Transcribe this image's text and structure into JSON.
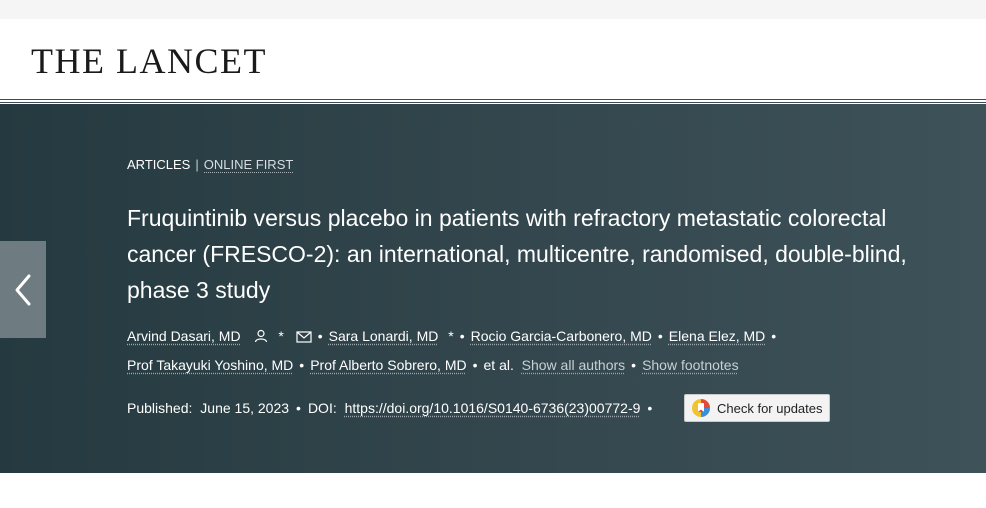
{
  "header": {
    "logo": "THE LANCET"
  },
  "article": {
    "type": "ARTICLES",
    "separator": "|",
    "status": "ONLINE FIRST",
    "title": "Fruquintinib versus placebo in patients with refractory metastatic colorectal cancer (FRESCO-2): an international, multicentre, randomised, double-blind, phase 3 study",
    "authors": [
      {
        "name": "Arvind Dasari, MD"
      },
      {
        "name": "Sara Lonardi, MD"
      },
      {
        "name": "Rocio Garcia-Carbonero, MD"
      },
      {
        "name": "Elena Elez, MD"
      },
      {
        "name": "Prof Takayuki Yoshino, MD"
      },
      {
        "name": "Prof Alberto Sobrero, MD"
      }
    ],
    "asterisk": "*",
    "bullet": "•",
    "et_al": "et al.",
    "show_all_authors": "Show all authors",
    "show_footnotes": "Show footnotes",
    "published_label": "Published:",
    "published_date": "June 15, 2023",
    "doi_label": "DOI:",
    "doi": "https://doi.org/10.1016/S0140-6736(23)00772-9",
    "check_updates": "Check for updates"
  },
  "icons": {
    "prev": "chevron-left-icon",
    "person": "person-icon",
    "mail": "mail-icon",
    "crossmark": "crossmark-icon"
  }
}
